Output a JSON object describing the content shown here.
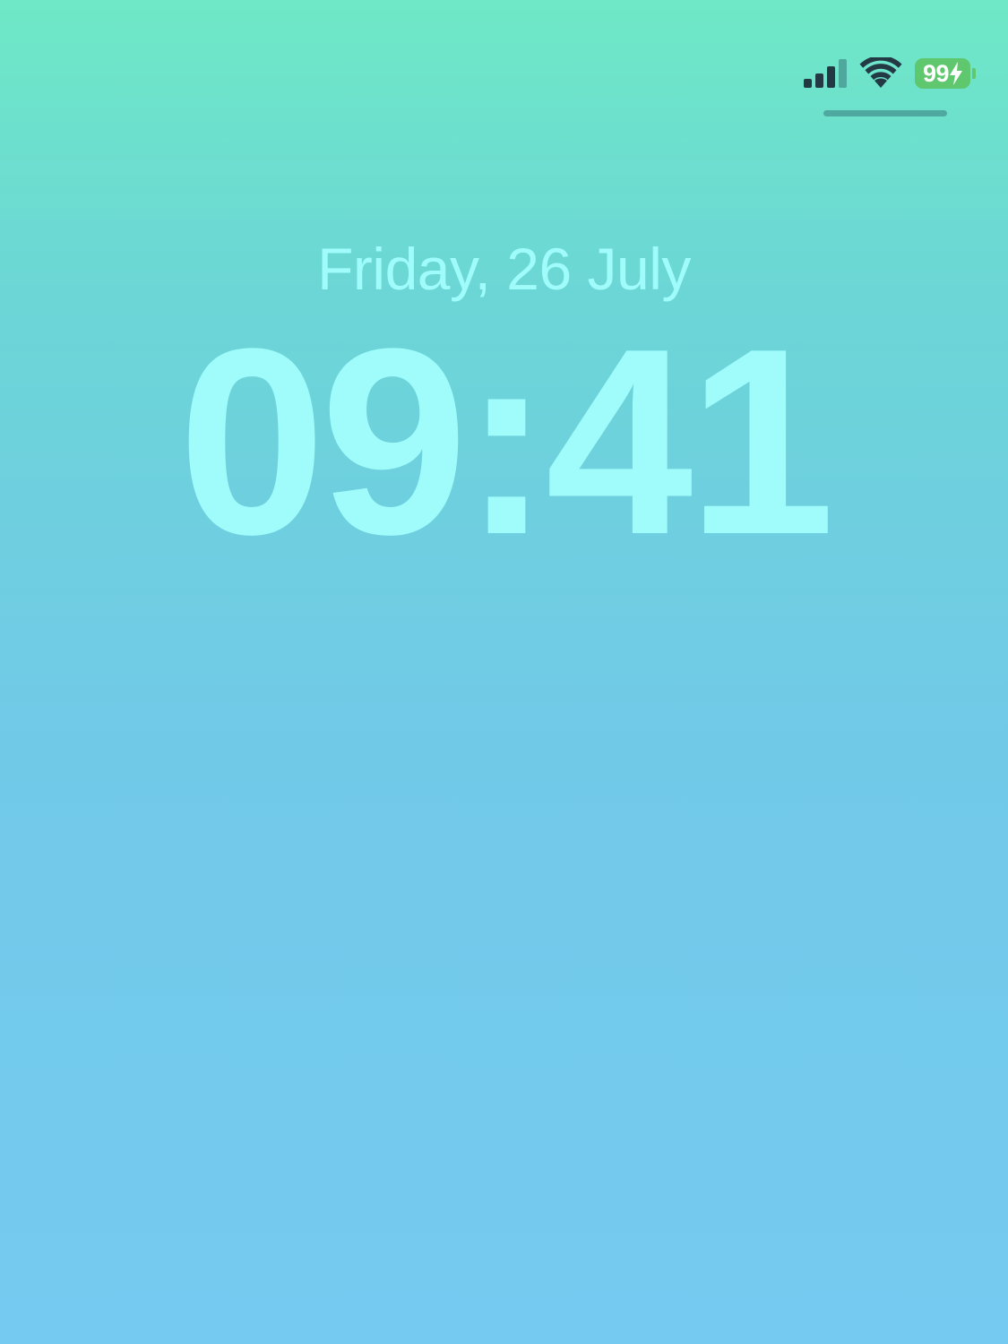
{
  "lock_screen": {
    "date": "Friday, 26 July",
    "time": "09:41"
  },
  "status_bar": {
    "signal_icon": "cellular-signal-icon",
    "signal_bars_filled": 3,
    "signal_bars_total": 4,
    "wifi_icon": "wifi-icon",
    "battery_icon": "battery-charging-icon",
    "battery_level": "99",
    "charging_icon": "lightning-bolt-icon"
  },
  "colors": {
    "text_primary": "#9ffcfb",
    "status_icons": "#233a45",
    "status_icons_dim": "#4fa89e",
    "battery_fill": "#5fc86e",
    "battery_text": "#ffffff",
    "indicator_line": "#4fa9a0"
  }
}
